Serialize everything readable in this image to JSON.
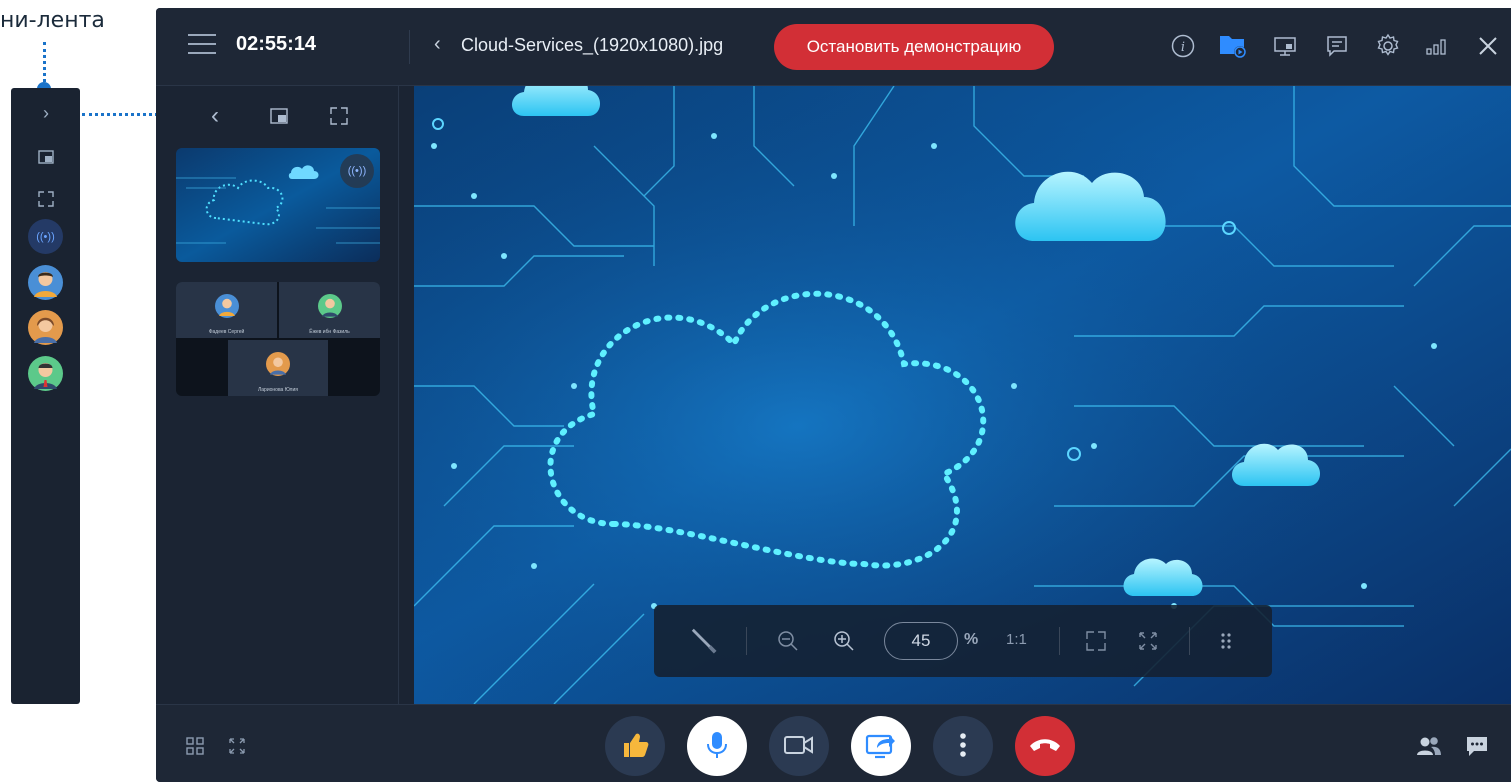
{
  "annotation": {
    "label": "ни-лента"
  },
  "topbar": {
    "timer": "02:55:14",
    "file_name": "Cloud-Services_(1920x1080).jpg",
    "stop_label": "Остановить демонстрацию"
  },
  "preview": {
    "participants": [
      {
        "name": "Фадеев Сергей"
      },
      {
        "name": "Ёжев ибн Фазиль"
      },
      {
        "name": "Ларионова Юлия"
      }
    ]
  },
  "zoom": {
    "value": "45",
    "percent_sign": "%",
    "one_to_one": "1:1"
  },
  "colors": {
    "accent": "#1a73c9",
    "danger": "#d22f36",
    "background": "#1b2433"
  },
  "icons": {
    "top": [
      "info-icon",
      "folder-play-icon",
      "screen-share-icon",
      "chat-list-icon",
      "settings-icon",
      "signal-icon",
      "close-icon"
    ],
    "panel": [
      "chevron-left-icon",
      "pip-icon",
      "expand-icon"
    ],
    "bottom_left": [
      "grid-layout-icon",
      "fullscreen-icon"
    ],
    "controls": [
      "thumbs-up-icon",
      "microphone-icon",
      "camera-icon",
      "share-screen-icon",
      "more-icon",
      "hangup-icon"
    ],
    "bottom_right": [
      "participants-icon",
      "chat-icon"
    ]
  }
}
